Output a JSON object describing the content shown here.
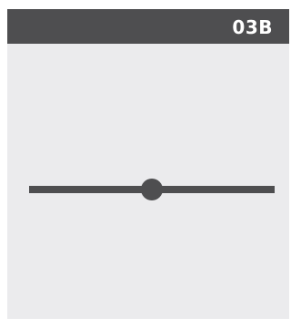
{
  "header": {
    "code": "03B"
  },
  "slider": {
    "value": 0.5
  },
  "colors": {
    "header_bg": "#4e4e50",
    "panel_bg": "#ebebed",
    "track": "#4e4e50",
    "thumb": "#4e4e50"
  }
}
